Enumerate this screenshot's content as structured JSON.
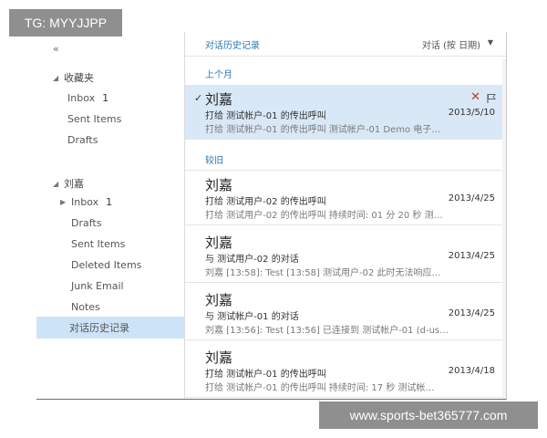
{
  "watermarks": {
    "top_left": "TG: MYYJJPP",
    "bottom_right": "www.sports-bet365777.com"
  },
  "sidebar": {
    "collapse_label": "«",
    "favorites": {
      "title": "收藏夹",
      "items": [
        {
          "label": "Inbox",
          "count": "1"
        },
        {
          "label": "Sent Items",
          "count": ""
        },
        {
          "label": "Drafts",
          "count": ""
        }
      ]
    },
    "account": {
      "title": "刘嘉",
      "items": [
        {
          "label": "Inbox",
          "count": "1"
        },
        {
          "label": "Drafts",
          "count": ""
        },
        {
          "label": "Sent Items",
          "count": ""
        },
        {
          "label": "Deleted Items",
          "count": ""
        },
        {
          "label": "Junk Email",
          "count": ""
        },
        {
          "label": "Notes",
          "count": ""
        },
        {
          "label": "对话历史记录",
          "count": ""
        }
      ]
    }
  },
  "main": {
    "title": "对话历史记录",
    "arrange_by": "对话 (按 日期)",
    "groups": [
      {
        "label": "上个月"
      },
      {
        "label": "较旧"
      }
    ],
    "messages": [
      {
        "sender": "刘嘉",
        "subject": "打给 测试帐户-01 的传出呼叫",
        "date": "2013/5/10",
        "preview": "打给 测试帐户-01 的传出呼叫 测试帐户-01 Demo 电子…"
      },
      {
        "sender": "刘嘉",
        "subject": "打给 测试用户-02 的传出呼叫",
        "date": "2013/4/25",
        "preview": "打给 测试用户-02 的传出呼叫 持续时间: 01 分 20 秒 测…"
      },
      {
        "sender": "刘嘉",
        "subject": "与 测试用户-02 的对话",
        "date": "2013/4/25",
        "preview": "刘嘉 [13:58]: Test [13:58] 测试用户-02 此时无法响应…"
      },
      {
        "sender": "刘嘉",
        "subject": "与 测试帐户-01 的对话",
        "date": "2013/4/25",
        "preview": "刘嘉 [13:56]: Test [13:56] 已连接到 测试帐户-01 (d-us…"
      },
      {
        "sender": "刘嘉",
        "subject": "打给 测试帐户-01 的传出呼叫",
        "date": "2013/4/18",
        "preview": "打给 测试帐户-01 的传出呼叫 持续时间: 17 秒 测试帐…"
      }
    ]
  },
  "colors": {
    "selected_folder": "#cde3f7",
    "selected_message": "#d9e8f6",
    "accent_blue": "#2a7ab8",
    "delete_red": "#c0392b"
  }
}
